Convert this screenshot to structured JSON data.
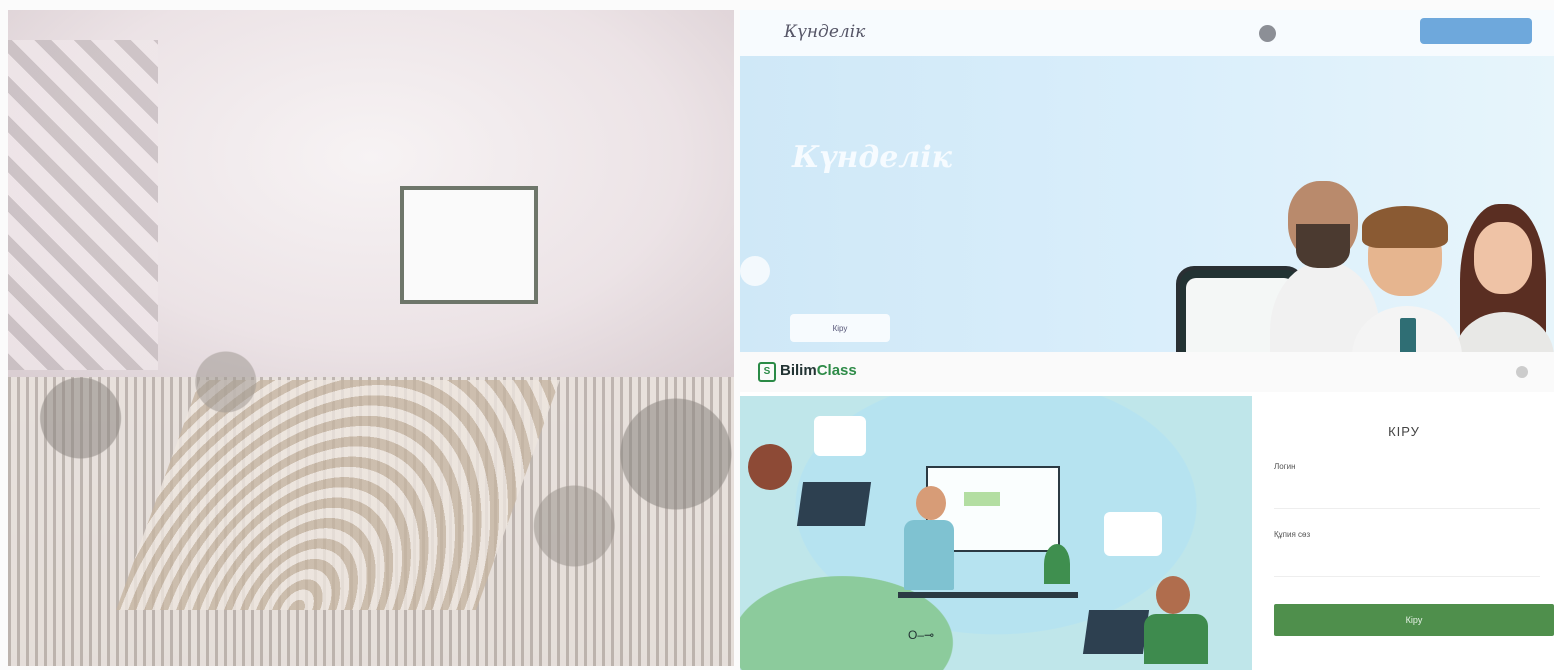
{
  "kundelik": {
    "logo": "Күнделік",
    "menu": [
      "",
      "",
      "",
      ""
    ],
    "nav_extra": "",
    "nav_extra2": "",
    "login_button": "",
    "hero_title": "Күнделік",
    "hero_description": "",
    "hero_button": "Кіру"
  },
  "bilimclass": {
    "logo_prefix": "Bilim",
    "logo_suffix": "Class",
    "login_title": "КІРУ",
    "login_label": "Логин",
    "login_hint": "",
    "login_placeholder": "",
    "password_label": "Құпия сөз",
    "password_placeholder": "",
    "submit_label": "Кіру",
    "footer_links": ""
  }
}
